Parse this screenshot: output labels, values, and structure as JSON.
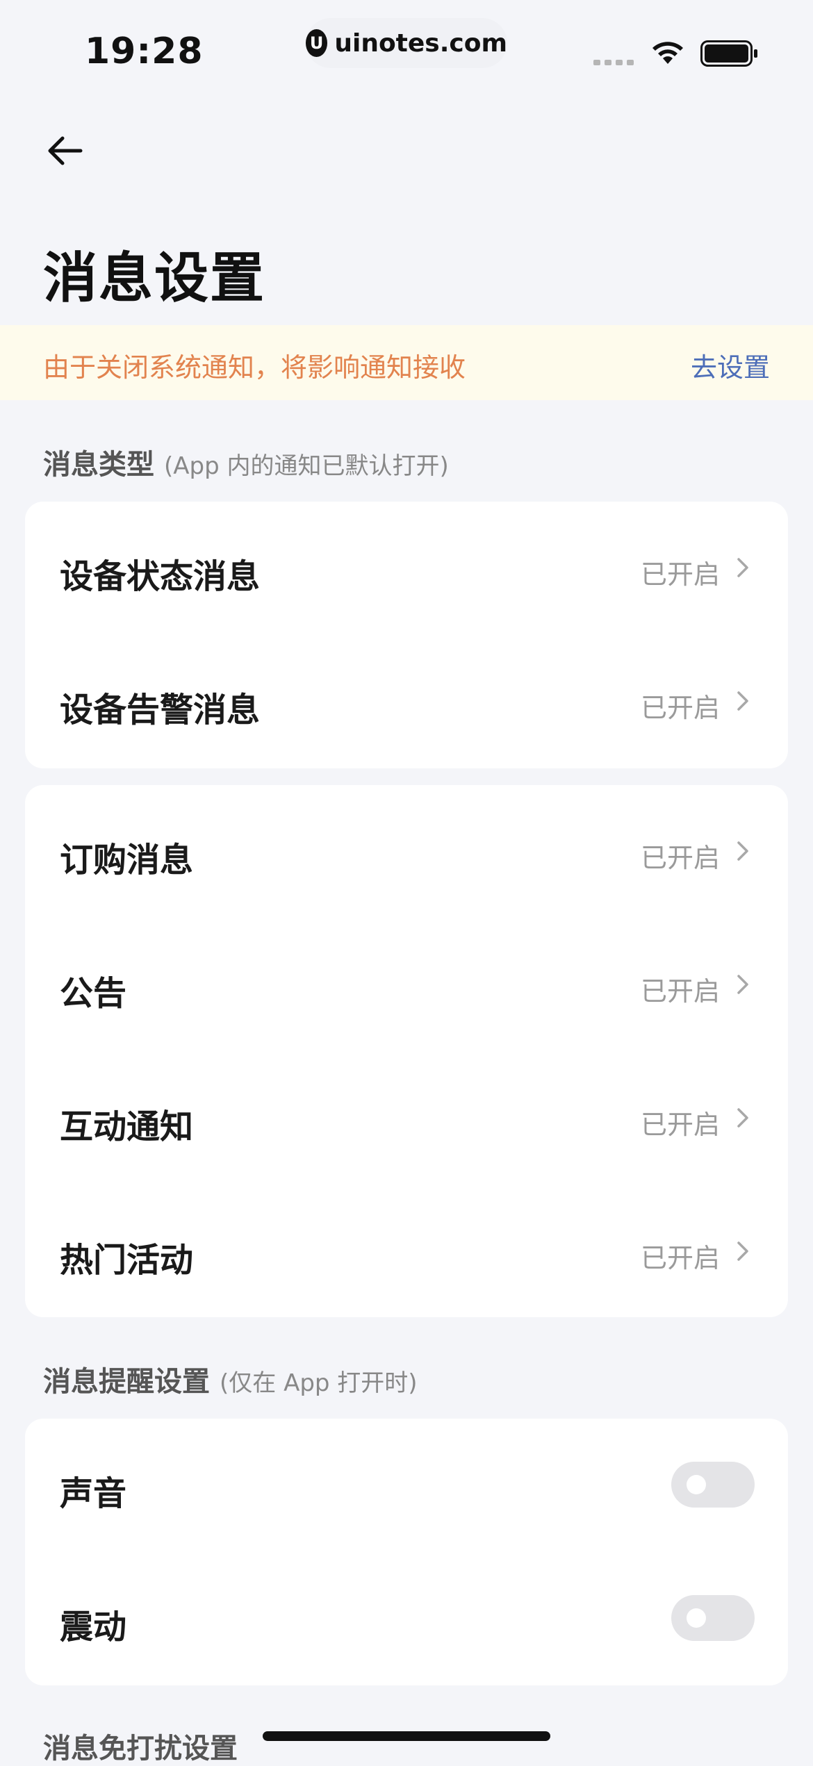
{
  "status_bar": {
    "time": "19:28",
    "watermark": "uinotes.com"
  },
  "header": {
    "title": "消息设置"
  },
  "banner": {
    "text": "由于关闭系统通知，将影响通知接收",
    "link": "去设置"
  },
  "sections": {
    "types": {
      "title": "消息类型",
      "note": "(App 内的通知已默认打开)"
    },
    "reminders": {
      "title": "消息提醒设置",
      "note": "(仅在 App 打开时)"
    },
    "dnd": {
      "title": "消息免打扰设置"
    }
  },
  "device_card": {
    "items": [
      {
        "label": "设备状态消息",
        "status": "已开启"
      },
      {
        "label": "设备告警消息",
        "status": "已开启"
      }
    ]
  },
  "general_card": {
    "items": [
      {
        "label": "订购消息",
        "status": "已开启"
      },
      {
        "label": "公告",
        "status": "已开启"
      },
      {
        "label": "互动通知",
        "status": "已开启"
      },
      {
        "label": "热门活动",
        "status": "已开启"
      }
    ]
  },
  "reminder_card": {
    "items": [
      {
        "label": "声音",
        "enabled": false
      },
      {
        "label": "震动",
        "enabled": false
      }
    ]
  },
  "colors": {
    "background": "#f4f5f9",
    "banner_bg": "#fefbec",
    "banner_text": "#e2834e",
    "link": "#4d6eb8",
    "toggle_off": "#e4e4e7"
  }
}
